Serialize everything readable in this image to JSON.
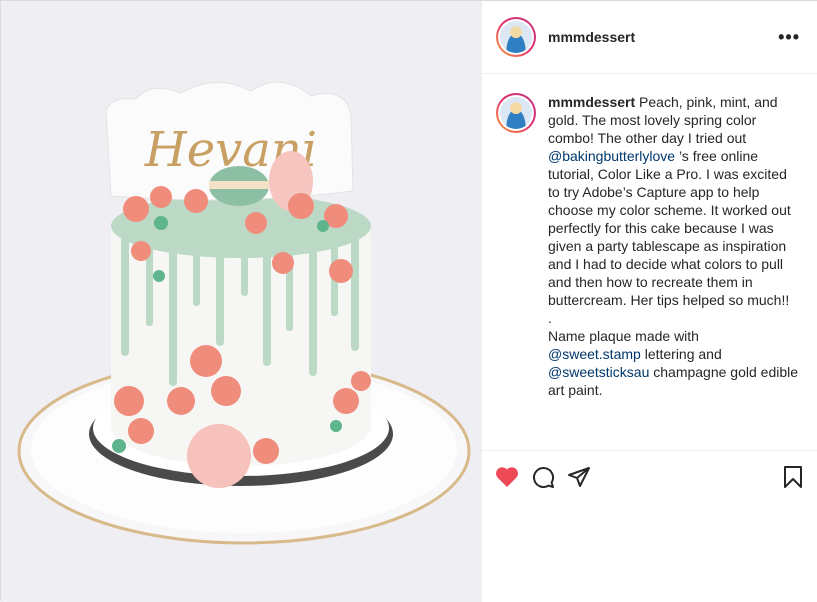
{
  "post": {
    "username": "mmmdessert",
    "more_label": "•••",
    "caption": {
      "username": "mmmdessert",
      "l1": " Peach, pink, mint, and gold. The most lovely spring color combo! The other day I tried out ",
      "m1": "@bakingbutterlylove",
      "l2": " ’s free online tutorial, Color Like a Pro. I was excited to try Adobe’s Capture app to help choose my color scheme. It worked out perfectly for this cake because I was given a party tablescape as inspiration and I had to decide what colors to pull and then how to recreate them in buttercream. Her tips helped so much!!",
      "dot": ".",
      "l3": "Name plaque made with ",
      "m2": "@sweet.stamp",
      "l4": " lettering and ",
      "m3": "@sweetsticksau",
      "l5": " champagne gold edible art paint."
    },
    "plaque_text": "Hevani",
    "liked": true,
    "colors": {
      "like": "#ed4956",
      "mention": "#00376b",
      "mint": "#bcd9c6",
      "peach": "#f08c7c",
      "gold": "#c9a063"
    },
    "icons": [
      "heart-icon",
      "comment-icon",
      "share-icon",
      "bookmark-icon",
      "more-icon"
    ]
  }
}
